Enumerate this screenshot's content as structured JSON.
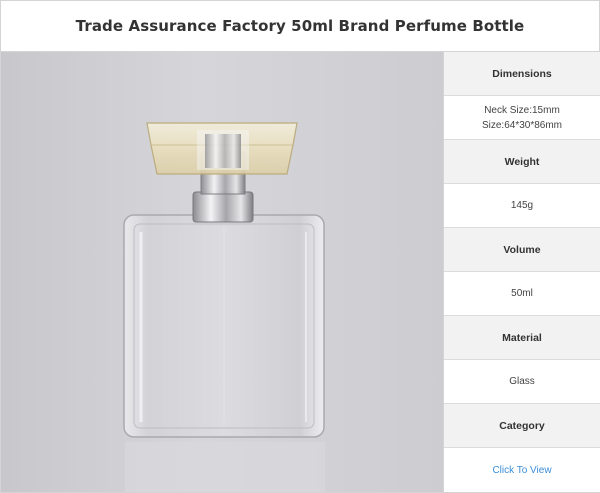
{
  "title": "Trade Assurance Factory 50ml Brand Perfume Bottle",
  "specs": {
    "dimensions_label": "Dimensions",
    "dimensions_neck": "Neck Size:15mm",
    "dimensions_size": "Size:64*30*86mm",
    "weight_label": "Weight",
    "weight_value": "145g",
    "volume_label": "Volume",
    "volume_value": "50ml",
    "material_label": "Material",
    "material_value": "Glass",
    "category_label": "Category",
    "category_link": "Click To View"
  },
  "colors": {
    "link": "#3b8ed8",
    "label_bg": "#f2f2f2",
    "border": "#d4d4d4"
  }
}
